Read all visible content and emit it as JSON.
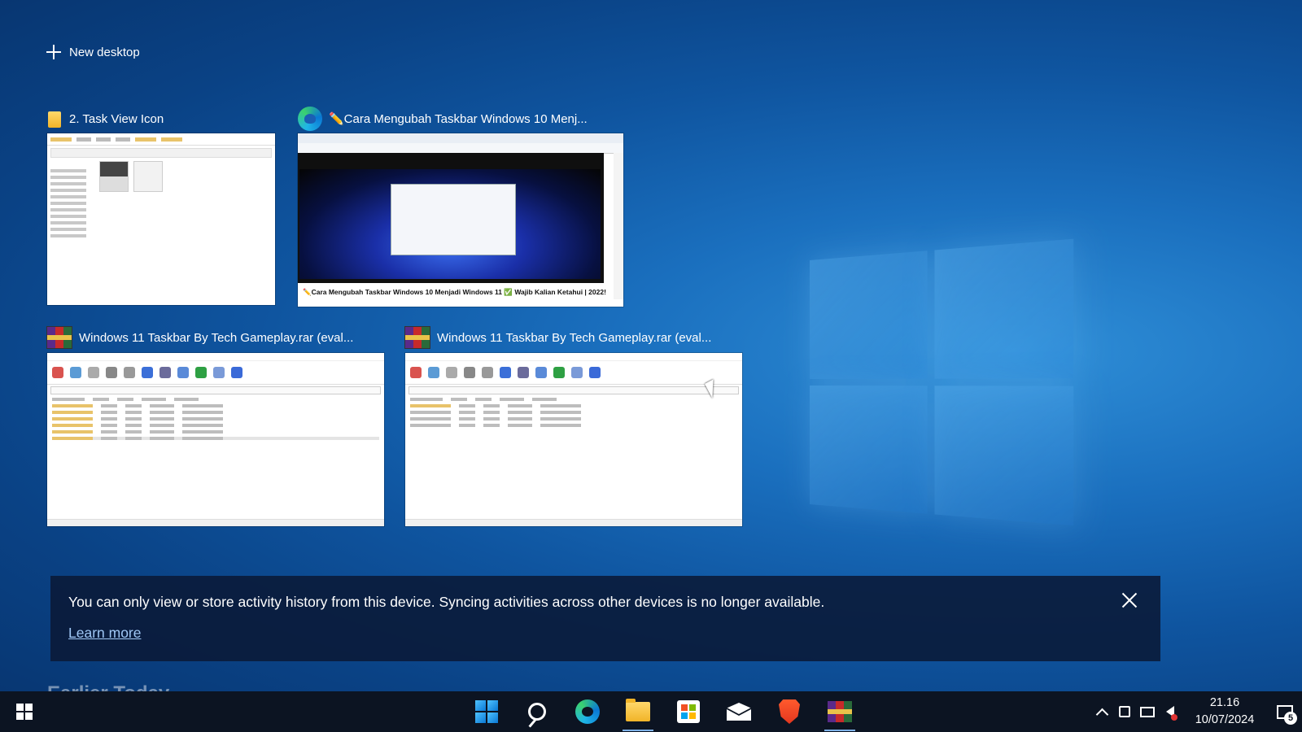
{
  "new_desktop": {
    "label": "New desktop"
  },
  "windows": [
    {
      "title": "2. Task View Icon",
      "app_icon": "file-explorer-icon"
    },
    {
      "title": "✏️Cara Mengubah Taskbar Windows 10 Menj...",
      "app_icon": "edge-icon",
      "thumbnail_caption": "✏️Cara Mengubah Taskbar Windows 10 Menjadi Windows 11 ✅ Wajib Kalian Ketahui | 2022!"
    },
    {
      "title": "Windows 11 Taskbar By Tech Gameplay.rar (eval...",
      "app_icon": "winrar-icon"
    },
    {
      "title": "Windows 11 Taskbar By Tech Gameplay.rar (eval...",
      "app_icon": "winrar-icon"
    }
  ],
  "notice": {
    "message": "You can only view or store activity history from this device. Syncing activities across other devices is no longer available.",
    "link": "Learn more"
  },
  "peek_heading": "Earlier Today",
  "taskbar": {
    "apps": [
      "windows-11-start-icon",
      "search-icon",
      "edge-icon",
      "file-explorer-icon",
      "microsoft-store-icon",
      "mail-icon",
      "brave-icon",
      "winrar-icon"
    ],
    "active_apps": [
      "file-explorer-icon",
      "winrar-icon"
    ],
    "time": "21.16",
    "date": "10/07/2024",
    "notification_count": "5"
  },
  "colors": {
    "desktop_blue": "#0f55a0",
    "taskbar": "#0c1422",
    "link": "#9fc7f5"
  }
}
